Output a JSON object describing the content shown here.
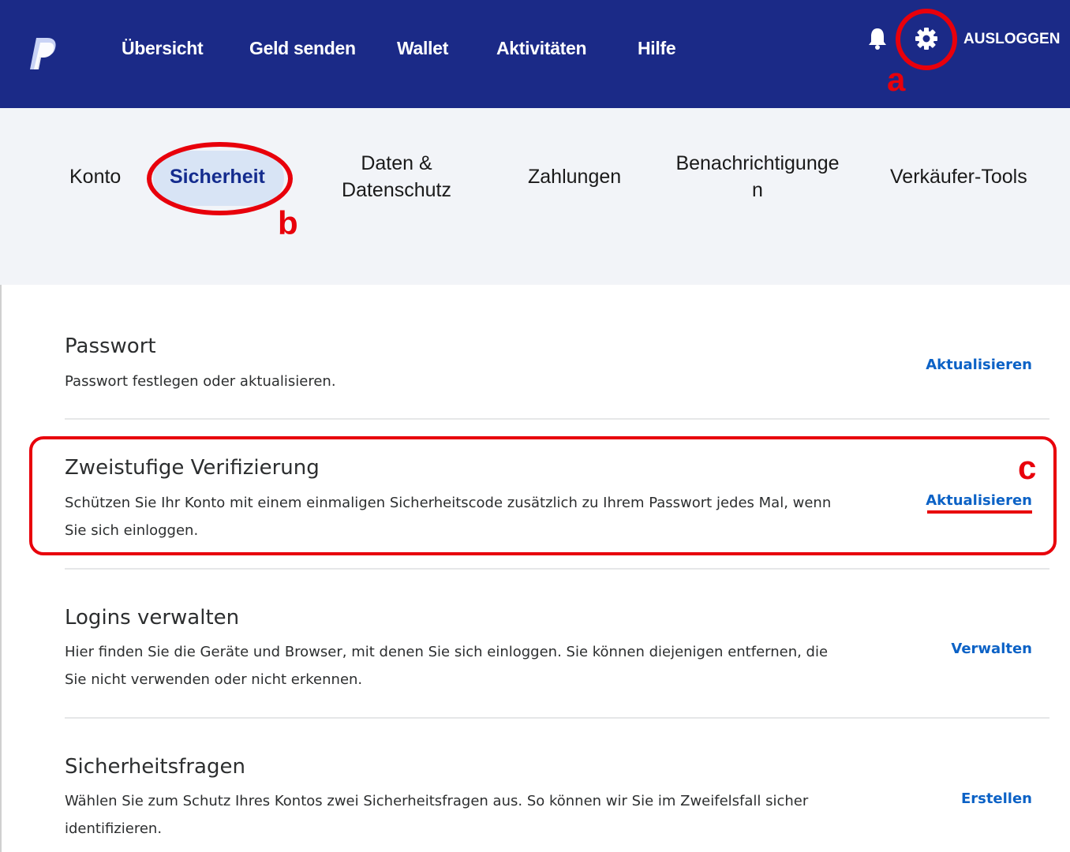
{
  "header": {
    "nav": [
      "Übersicht",
      "Geld senden",
      "Wallet",
      "Aktivitäten",
      "Hilfe"
    ],
    "logout_label": "AUSLOGGEN",
    "brand_color": "#1b2a87"
  },
  "tabs": {
    "konto": "Konto",
    "sicherheit": "Sicherheit",
    "daten_line1": "Daten &",
    "daten_line2": "Datenschutz",
    "zahlungen": "Zahlungen",
    "benach_line1": "Benachrichtigunge",
    "benach_line2": "n",
    "verkaeufer": "Verkäufer-Tools",
    "active": "Sicherheit"
  },
  "annotations": {
    "a": "a",
    "b": "b",
    "c": "c",
    "color": "#e8000b"
  },
  "sections": [
    {
      "title": "Passwort",
      "description": "Passwort festlegen oder aktualisieren.",
      "action": "Aktualisieren"
    },
    {
      "title": "Zweistufige Verifizierung",
      "description": "Schützen Sie Ihr Konto mit einem einmaligen Sicherheitscode zusätzlich zu Ihrem Passwort jedes Mal, wenn Sie sich einloggen.",
      "action": "Aktualisieren"
    },
    {
      "title": "Logins verwalten",
      "description": "Hier finden Sie die Geräte und Browser, mit denen Sie sich einloggen. Sie können diejenigen entfernen, die Sie nicht verwenden oder nicht erkennen.",
      "action": "Verwalten"
    },
    {
      "title": "Sicherheitsfragen",
      "description": "Wählen Sie zum Schutz Ihres Kontos zwei Sicherheitsfragen aus. So können wir Sie im Zweifelsfall sicher identifizieren.",
      "action": "Erstellen"
    }
  ]
}
